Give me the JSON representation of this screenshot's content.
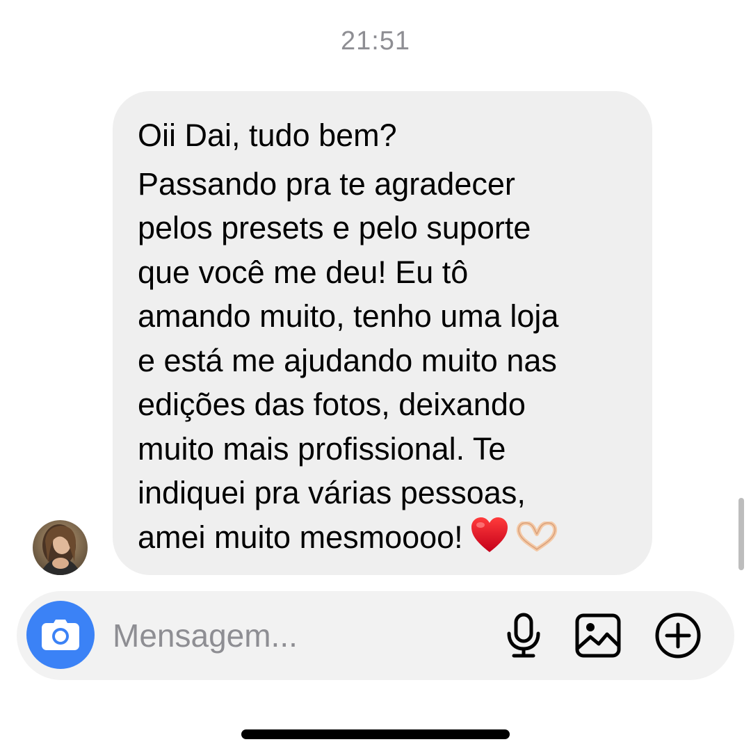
{
  "chat": {
    "timestamp": "21:51",
    "message": {
      "lines": [
        "Oii Dai, tudo bem?",
        "Passando pra te agradecer",
        "pelos presets e pelo suporte",
        "que você me deu! Eu tô",
        "amando muito, tenho uma loja",
        "e está me ajudando muito nas",
        "edições das fotos, deixando",
        "muito mais profissional. Te",
        "indiquei pra várias pessoas,",
        "amei muito mesmoooo!"
      ],
      "trailing_emojis": [
        "heart-emoji",
        "heart-hands-emoji"
      ]
    },
    "sender_avatar": "avatar"
  },
  "composer": {
    "placeholder": "Mensagem...",
    "value": "",
    "camera_icon": "camera-icon",
    "mic_icon": "microphone-icon",
    "gallery_icon": "gallery-icon",
    "add_icon": "plus-circle-icon",
    "accent_color": "#3b82f6"
  },
  "colors": {
    "bubble": "#efefef",
    "composer_bg": "#f2f2f2",
    "timestamp": "#8e8e93"
  }
}
